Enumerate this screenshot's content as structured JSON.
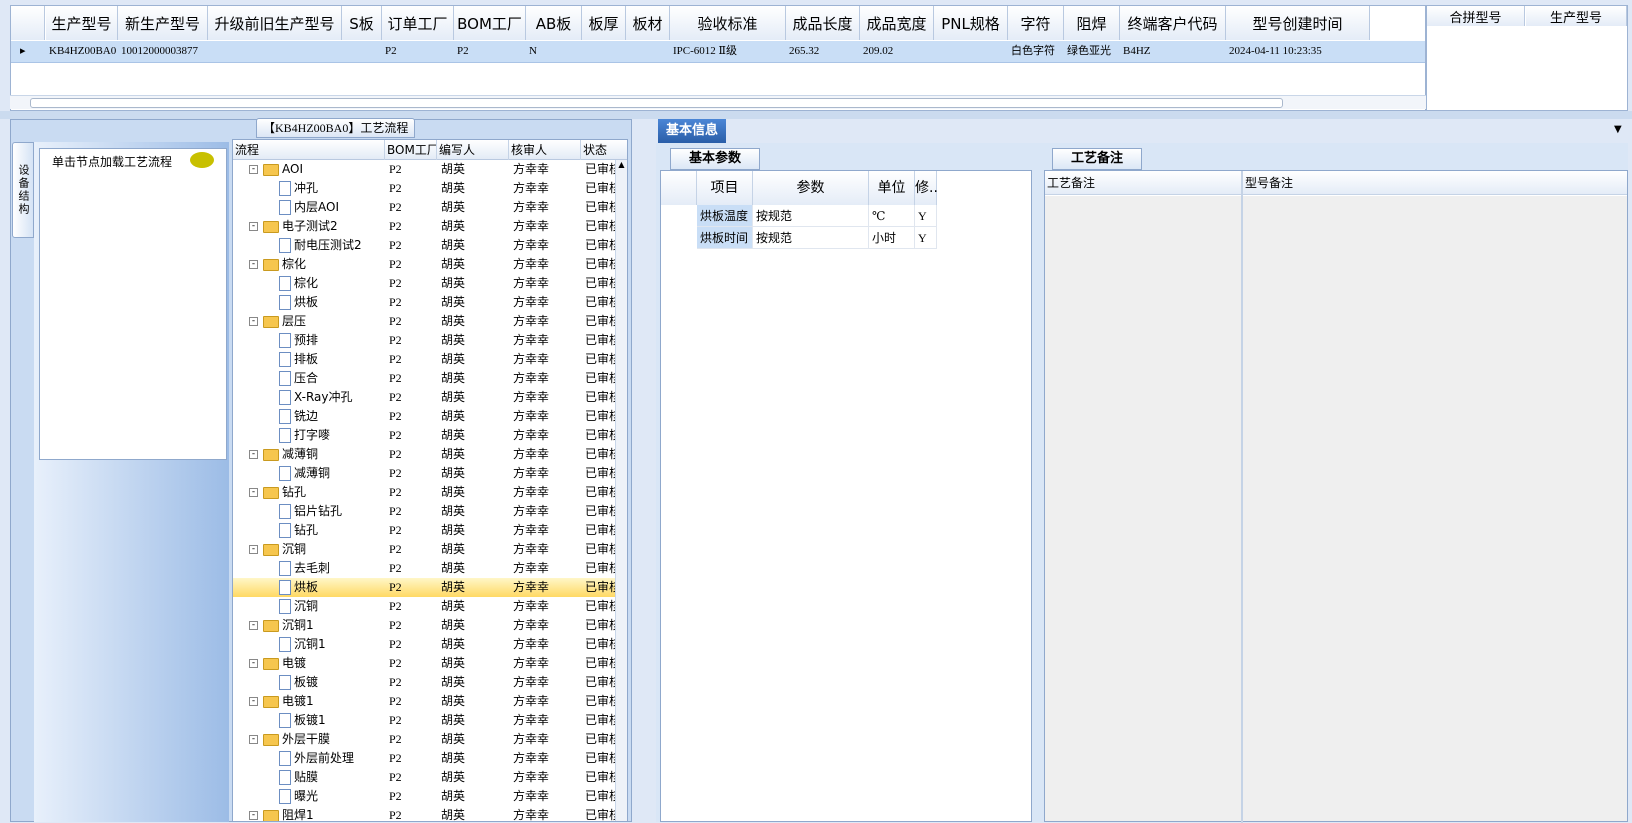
{
  "top_grid": {
    "columns": [
      "生产型号",
      "新生产型号",
      "升级前旧生产型号",
      "S板",
      "订单工厂",
      "BOM工厂",
      "AB板",
      "板厚",
      "板材",
      "验收标准",
      "成品长度",
      "成品宽度",
      "PNL规格",
      "字符",
      "阻焊",
      "终端客户代码",
      "型号创建时间"
    ],
    "row": [
      "KB4HZ00BA0",
      "10012000003877",
      "",
      "",
      "P2",
      "P2",
      "N",
      "",
      "",
      "IPC-6012 Ⅱ级",
      "265.32",
      "209.02",
      "",
      "白色字符",
      "绿色亚光",
      "B4HZ",
      "2024-04-11 10:23:35"
    ]
  },
  "right_grid": {
    "columns": [
      "合拼型号",
      "生产型号"
    ]
  },
  "left_panel": {
    "vertical_tab": "设备结构",
    "click_hint": "单击节点加载工艺流程",
    "tree_title": "【KB4HZ00BA0】工艺流程",
    "tree_columns": [
      "流程",
      "BOM工厂",
      "编写人",
      "核审人",
      "状态"
    ],
    "rows": [
      {
        "n": "AOI",
        "f": 1,
        "b": "P2",
        "w": "胡英",
        "r": "方幸幸",
        "s": "已审核"
      },
      {
        "n": "冲孔",
        "f": 0,
        "b": "P2",
        "w": "胡英",
        "r": "方幸幸",
        "s": "已审核"
      },
      {
        "n": "内层AOI",
        "f": 0,
        "b": "P2",
        "w": "胡英",
        "r": "方幸幸",
        "s": "已审核"
      },
      {
        "n": "电子测试2",
        "f": 1,
        "b": "P2",
        "w": "胡英",
        "r": "方幸幸",
        "s": "已审核"
      },
      {
        "n": "耐电压测试2",
        "f": 0,
        "b": "P2",
        "w": "胡英",
        "r": "方幸幸",
        "s": "已审核"
      },
      {
        "n": "棕化",
        "f": 1,
        "b": "P2",
        "w": "胡英",
        "r": "方幸幸",
        "s": "已审核"
      },
      {
        "n": "棕化",
        "f": 0,
        "b": "P2",
        "w": "胡英",
        "r": "方幸幸",
        "s": "已审核"
      },
      {
        "n": "烘板",
        "f": 0,
        "b": "P2",
        "w": "胡英",
        "r": "方幸幸",
        "s": "已审核"
      },
      {
        "n": "层压",
        "f": 1,
        "b": "P2",
        "w": "胡英",
        "r": "方幸幸",
        "s": "已审核"
      },
      {
        "n": "预排",
        "f": 0,
        "b": "P2",
        "w": "胡英",
        "r": "方幸幸",
        "s": "已审核"
      },
      {
        "n": "排板",
        "f": 0,
        "b": "P2",
        "w": "胡英",
        "r": "方幸幸",
        "s": "已审核"
      },
      {
        "n": "压合",
        "f": 0,
        "b": "P2",
        "w": "胡英",
        "r": "方幸幸",
        "s": "已审核"
      },
      {
        "n": "X-Ray冲孔",
        "f": 0,
        "b": "P2",
        "w": "胡英",
        "r": "方幸幸",
        "s": "已审核"
      },
      {
        "n": "铣边",
        "f": 0,
        "b": "P2",
        "w": "胡英",
        "r": "方幸幸",
        "s": "已审核"
      },
      {
        "n": "打字嘜",
        "f": 0,
        "b": "P2",
        "w": "胡英",
        "r": "方幸幸",
        "s": "已审核"
      },
      {
        "n": "减薄铜",
        "f": 1,
        "b": "P2",
        "w": "胡英",
        "r": "方幸幸",
        "s": "已审核"
      },
      {
        "n": "减薄铜",
        "f": 0,
        "b": "P2",
        "w": "胡英",
        "r": "方幸幸",
        "s": "已审核"
      },
      {
        "n": "钻孔",
        "f": 1,
        "b": "P2",
        "w": "胡英",
        "r": "方幸幸",
        "s": "已审核"
      },
      {
        "n": "铝片钻孔",
        "f": 0,
        "b": "P2",
        "w": "胡英",
        "r": "方幸幸",
        "s": "已审核"
      },
      {
        "n": "钻孔",
        "f": 0,
        "b": "P2",
        "w": "胡英",
        "r": "方幸幸",
        "s": "已审核"
      },
      {
        "n": "沉铜",
        "f": 1,
        "b": "P2",
        "w": "胡英",
        "r": "方幸幸",
        "s": "已审核"
      },
      {
        "n": "去毛刺",
        "f": 0,
        "b": "P2",
        "w": "胡英",
        "r": "方幸幸",
        "s": "已审核"
      },
      {
        "n": "烘板",
        "f": 0,
        "b": "P2",
        "w": "胡英",
        "r": "方幸幸",
        "s": "已审核",
        "sel": 1
      },
      {
        "n": "沉铜",
        "f": 0,
        "b": "P2",
        "w": "胡英",
        "r": "方幸幸",
        "s": "已审核"
      },
      {
        "n": "沉铜1",
        "f": 1,
        "b": "P2",
        "w": "胡英",
        "r": "方幸幸",
        "s": "已审核"
      },
      {
        "n": "沉铜1",
        "f": 0,
        "b": "P2",
        "w": "胡英",
        "r": "方幸幸",
        "s": "已审核"
      },
      {
        "n": "电镀",
        "f": 1,
        "b": "P2",
        "w": "胡英",
        "r": "方幸幸",
        "s": "已审核"
      },
      {
        "n": "板镀",
        "f": 0,
        "b": "P2",
        "w": "胡英",
        "r": "方幸幸",
        "s": "已审核"
      },
      {
        "n": "电镀1",
        "f": 1,
        "b": "P2",
        "w": "胡英",
        "r": "方幸幸",
        "s": "已审核"
      },
      {
        "n": "板镀1",
        "f": 0,
        "b": "P2",
        "w": "胡英",
        "r": "方幸幸",
        "s": "已审核"
      },
      {
        "n": "外层干膜",
        "f": 1,
        "b": "P2",
        "w": "胡英",
        "r": "方幸幸",
        "s": "已审核"
      },
      {
        "n": "外层前处理",
        "f": 0,
        "b": "P2",
        "w": "胡英",
        "r": "方幸幸",
        "s": "已审核"
      },
      {
        "n": "贴膜",
        "f": 0,
        "b": "P2",
        "w": "胡英",
        "r": "方幸幸",
        "s": "已审核"
      },
      {
        "n": "曝光",
        "f": 0,
        "b": "P2",
        "w": "胡英",
        "r": "方幸幸",
        "s": "已审核"
      },
      {
        "n": "阻焊1",
        "f": 1,
        "b": "P2",
        "w": "胡英",
        "r": "方幸幸",
        "s": "已审核"
      }
    ]
  },
  "middle": {
    "main_tab": "基本信息",
    "param_tab": "基本参数",
    "notes_tab": "工艺备注",
    "param_columns": [
      "项目",
      "参数",
      "单位",
      "修.."
    ],
    "param_rows": [
      [
        "烘板温度",
        "按规范",
        "℃",
        "Y"
      ],
      [
        "烘板时间",
        "按规范",
        "小时",
        "Y"
      ]
    ],
    "note_columns": [
      "工艺备注",
      "型号备注"
    ]
  }
}
